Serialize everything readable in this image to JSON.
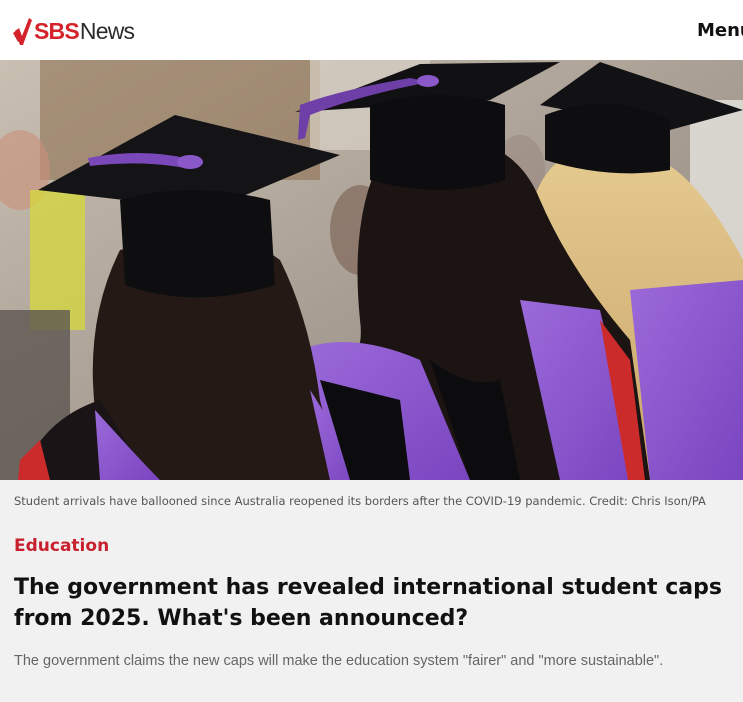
{
  "header": {
    "logo_brand": "SBS",
    "logo_suffix": "News",
    "menu_label": "Menu"
  },
  "hero": {
    "image_subject": "graduates-in-mortarboards",
    "caption": "Student arrivals have ballooned since Australia reopened its borders after the COVID-19 pandemic. Credit: Chris Ison/PA"
  },
  "article": {
    "category": "Education",
    "headline": "The government has revealed international student caps from 2025. What's been announced?",
    "standfirst": "The government claims the new caps will make the education system \"fairer\" and \"more sustainable\"."
  },
  "colors": {
    "brand_red": "#d4232b",
    "category_red": "#c8202f",
    "page_background": "#f1f1f1"
  }
}
